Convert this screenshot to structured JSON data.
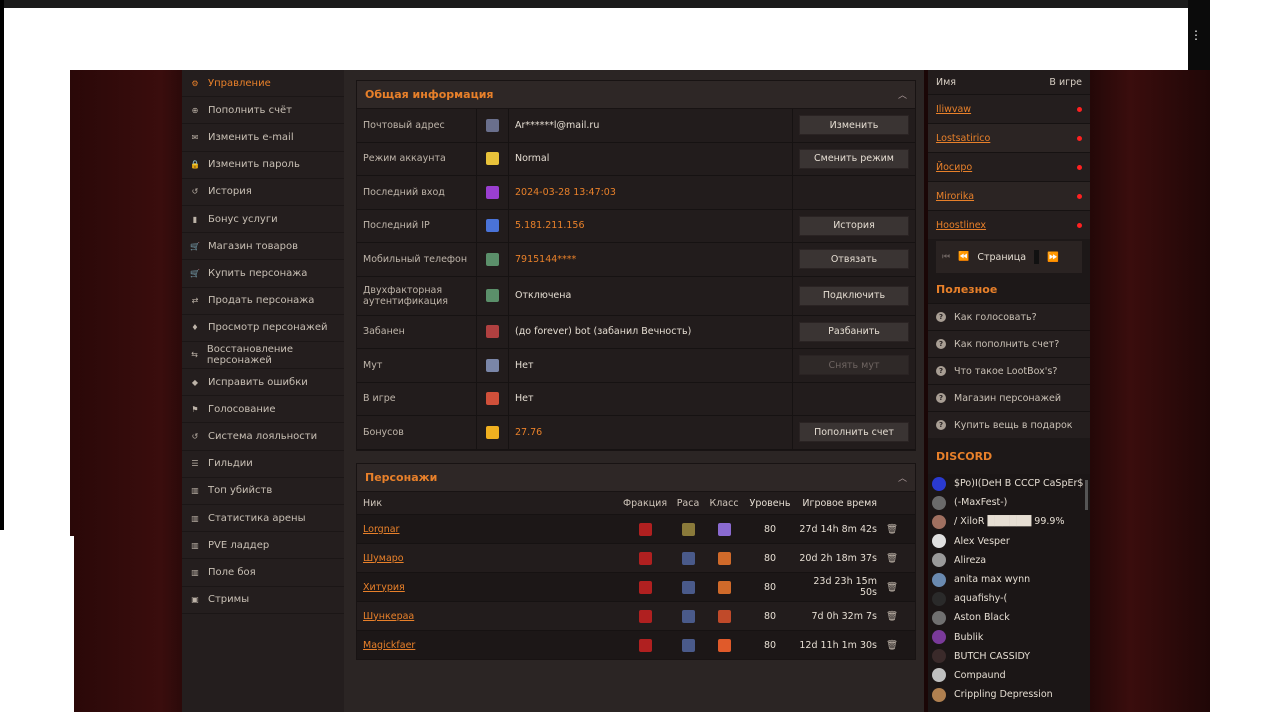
{
  "browser": {
    "menu_glyph": "⋮"
  },
  "sidebar": {
    "items": [
      {
        "label": "Управление",
        "icon": "gear-icon",
        "active": true
      },
      {
        "label": "Пополнить счёт",
        "icon": "plus-circle-icon"
      },
      {
        "label": "Изменить e-mail",
        "icon": "envelope-icon"
      },
      {
        "label": "Изменить пароль",
        "icon": "lock-icon"
      },
      {
        "label": "История",
        "icon": "history-icon"
      },
      {
        "label": "Бонус услуги",
        "icon": "bonus-icon"
      },
      {
        "label": "Магазин товаров",
        "icon": "cart-icon"
      },
      {
        "label": "Купить персонажа",
        "icon": "cart-icon"
      },
      {
        "label": "Продать персонажа",
        "icon": "sell-icon"
      },
      {
        "label": "Просмотр персонажей",
        "icon": "person-icon"
      },
      {
        "label": "Восстановление персонажей",
        "icon": "restore-icon"
      },
      {
        "label": "Исправить ошибки",
        "icon": "shield-icon"
      },
      {
        "label": "Голосование",
        "icon": "flag-icon"
      },
      {
        "label": "Система лояльности",
        "icon": "history-icon"
      },
      {
        "label": "Гильдии",
        "icon": "users-icon"
      },
      {
        "label": "Топ убийств",
        "icon": "chart-icon"
      },
      {
        "label": "Статистика арены",
        "icon": "chart-icon"
      },
      {
        "label": "PVE ладдер",
        "icon": "chart-icon"
      },
      {
        "label": "Поле боя",
        "icon": "chart-icon"
      },
      {
        "label": "Стримы",
        "icon": "stream-icon"
      }
    ]
  },
  "info": {
    "title": "Общая информация",
    "rows": [
      {
        "label": "Почтовый адрес",
        "value": "Ar******l@mail.ru",
        "button": "Изменить",
        "orange": false,
        "icon_color": "#6a6f8c"
      },
      {
        "label": "Режим аккаунта",
        "value": "Normal",
        "button": "Сменить режим",
        "orange": false,
        "icon_color": "#e8c23a"
      },
      {
        "label": "Последний вход",
        "value": "2024-03-28 13:47:03",
        "button": "",
        "orange": true,
        "icon_color": "#9a3fd0"
      },
      {
        "label": "Последний IP",
        "value": "5.181.211.156",
        "button": "История",
        "orange": true,
        "icon_color": "#4a73d8"
      },
      {
        "label": "Мобильный телефон",
        "value": "7915144****",
        "button": "Отвязать",
        "orange": true,
        "icon_color": "#5b8f6a"
      },
      {
        "label": "Двухфакторная аутентификация",
        "value": "Отключена",
        "button": "Подключить",
        "orange": false,
        "icon_color": "#5b8f6a"
      },
      {
        "label": "Забанен",
        "value": "(до forever) bot (забанил Вечность)",
        "button": "Разбанить",
        "orange": false,
        "icon_color": "#b04040"
      },
      {
        "label": "Мут",
        "value": "Нет",
        "button": "Снять мут",
        "orange": false,
        "disabled": true,
        "icon_color": "#7a86a8"
      },
      {
        "label": "В игре",
        "value": "Нет",
        "button": "",
        "orange": false,
        "icon_color": "#d0503a"
      },
      {
        "label": "Бонусов",
        "value": "27.76",
        "button": "Пополнить счет",
        "orange": true,
        "icon_color": "#f0b020"
      }
    ]
  },
  "characters": {
    "title": "Персонажи",
    "columns": [
      "Ник",
      "Фракция",
      "Раса",
      "Класс",
      "Уровень",
      "Игровое время"
    ],
    "rows": [
      {
        "nick": "Lorgnar",
        "level": "80",
        "time": "27d 14h 8m 42s",
        "race_color": "#8a7a3a",
        "class_color": "#8a6ad0"
      },
      {
        "nick": "Шумаро",
        "level": "80",
        "time": "20d 2h 18m 37s",
        "race_color": "#4a5a8a",
        "class_color": "#d06a2a"
      },
      {
        "nick": "Хитурия",
        "level": "80",
        "time": "23d 23h 15m 50s",
        "race_color": "#4a5a8a",
        "class_color": "#d06a2a"
      },
      {
        "nick": "Шункераа",
        "level": "80",
        "time": "7d 0h 32m 7s",
        "race_color": "#4a5a8a",
        "class_color": "#c04a2a"
      },
      {
        "nick": "Magickfaer",
        "level": "80",
        "time": "12d 11h 1m 30s",
        "race_color": "#4a5a8a",
        "class_color": "#e05a2a"
      }
    ]
  },
  "online": {
    "col_name": "Имя",
    "col_ingame": "В игре",
    "players": [
      "Iliwvaw",
      "Lostsatirico",
      "Йосиро",
      "Mirorika",
      "Hoostlinex"
    ],
    "pager_label": "Страница",
    "pager_first": "⏮",
    "pager_prev": "⏪",
    "pager_next": "⏩"
  },
  "useful": {
    "title": "Полезное",
    "items": [
      "Как голосовать?",
      "Как пополнить счет?",
      "Что такое LootBox's?",
      "Магазин персонажей",
      "Купить вещь в подарок"
    ]
  },
  "discord": {
    "title": "DISCORD",
    "members": [
      {
        "name": "$Po)I(DeH B CCCP CaSpEr$",
        "color": "#2a3ad0"
      },
      {
        "name": "(-MaxFest-)",
        "color": "#6a6a6a"
      },
      {
        "name": "/ XiloR ██████ 99.9%",
        "color": "#a07060"
      },
      {
        "name": "Alex Vesper",
        "color": "#e0e0e0"
      },
      {
        "name": "Alireza",
        "color": "#9a9a9a"
      },
      {
        "name": "anita max wynn",
        "color": "#6a8ab0"
      },
      {
        "name": "aquafishy-(",
        "color": "#2a2a2a"
      },
      {
        "name": "Aston Black",
        "color": "#707070"
      },
      {
        "name": "Bublik",
        "color": "#7a3a9a"
      },
      {
        "name": "BUTCH CASSIDY",
        "color": "#3a2a2a"
      },
      {
        "name": "Compaund",
        "color": "#c0c0c0"
      },
      {
        "name": "Crippling Depression",
        "color": "#b08050"
      }
    ]
  }
}
